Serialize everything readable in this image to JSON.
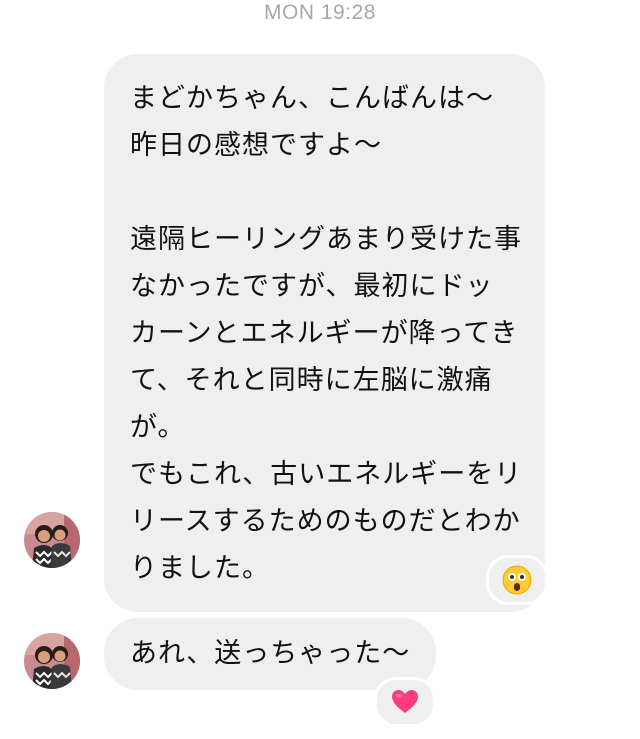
{
  "thread": {
    "timestamp": "MON 19:28",
    "messages": [
      {
        "lines": [
          "まどかちゃん、こんばんは〜",
          "昨日の感想ですよ〜",
          "",
          "遠隔ヒーリングあまり受けた事",
          "なかったですが、最初にドッ",
          "カーンとエネルギーが降ってき",
          "て、それと同時に左脳に激痛",
          "が。",
          "でもこれ、古いエネルギーをリ",
          "リースするためのものだとわか",
          "りました。"
        ],
        "reaction": "astonished-face-emoji"
      },
      {
        "text": "あれ、送っちゃった〜",
        "reaction": "pink-heart-emoji"
      }
    ],
    "colors": {
      "bubble": "#efefef",
      "timestamp": "#a8a8a8",
      "heart": "#ff3b7f"
    }
  }
}
